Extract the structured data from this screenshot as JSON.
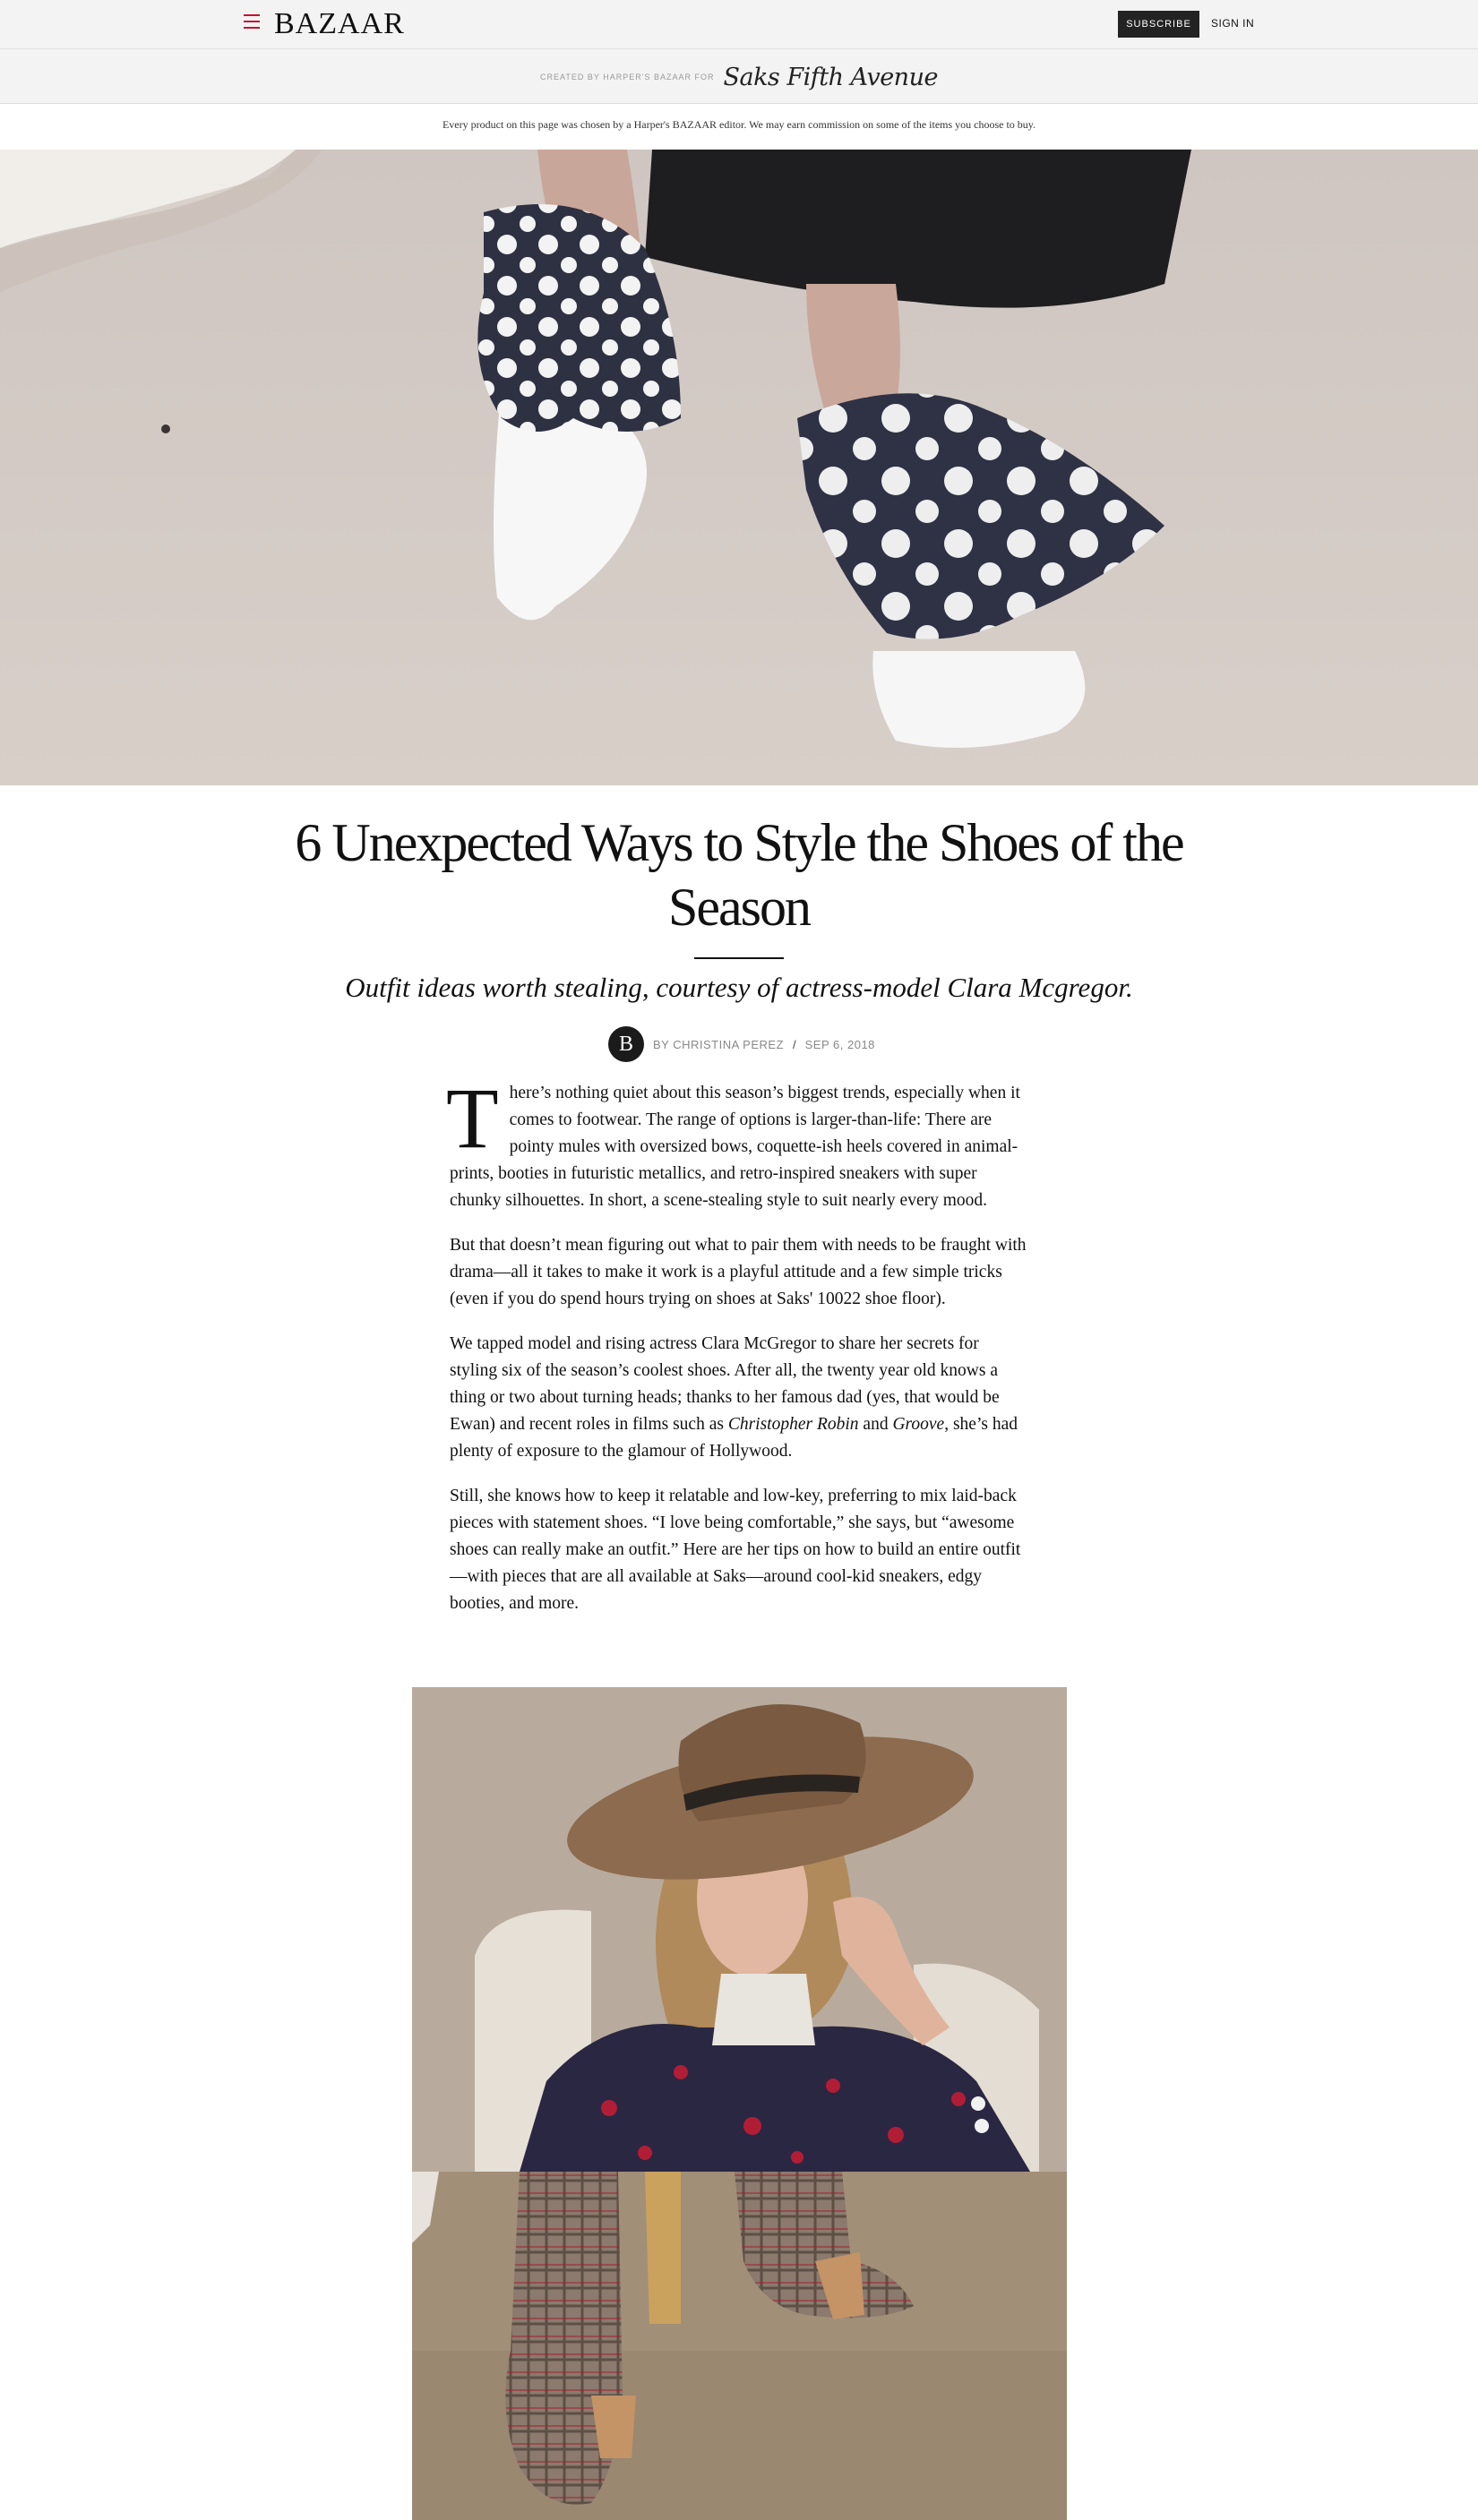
{
  "header": {
    "logo": "BAZAAR",
    "subscribe_label": "SUBSCRIBE",
    "signin_label": "SIGN IN"
  },
  "sponsor": {
    "label": "CREATED BY HARPER'S BAZAAR FOR",
    "partner": "Saks Fifth Avenue"
  },
  "disclaimer": "Every product on this page was chosen by a Harper's BAZAAR editor. We may earn commission on some of the items you choose to buy.",
  "article": {
    "title": "6 Unexpected Ways to Style the Shoes of the Season",
    "dek": "Outfit ideas worth stealing, courtesy of actress-model Clara Mcgregor.",
    "author_initial": "B",
    "byline": "BY CHRISTINA PEREZ",
    "date": "SEP 6, 2018",
    "dropcap": "T",
    "p1_rest": "here’s nothing quiet about this season’s biggest trends, especially when it comes to footwear. The range of options is larger-than-life: There are pointy mules with oversized bows, coquette-ish heels covered in animal-prints, booties in futuristic metallics, and retro-inspired sneakers with super chunky silhouettes. In short, a scene-stealing style to suit nearly every mood.",
    "p2": "But that doesn’t mean figuring out what to pair them with needs to be fraught with drama—all it takes to make it work is a playful attitude and a few simple tricks (even if you do spend hours trying on shoes at Saks' 10022 shoe floor).",
    "p3_a": "We tapped model and rising actress Clara McGregor to share her secrets for styling six of the season’s coolest shoes. After all, the twenty year old knows a thing or two about turning heads; thanks to her famous dad (yes, that would be Ewan) and recent roles in films such as ",
    "p3_film1": "Christopher Robin",
    "p3_and": " and ",
    "p3_film2": "Groove",
    "p3_b": ", she’s had plenty of exposure to the glamour of Hollywood.",
    "p4": "Still, she knows how to keep it relatable and low-key, preferring to mix laid-back pieces with statement shoes. “I love being comfortable,” she says, but “awesome shoes can really make an outfit.” Here are her tips on how to build an entire outfit—with pieces that are all available at Saks—around cool-kid sneakers, edgy booties, and more."
  },
  "colors": {
    "accent_red": "#c8102e",
    "topbar_bg": "#f3f3f3",
    "button_bg": "#232323"
  }
}
